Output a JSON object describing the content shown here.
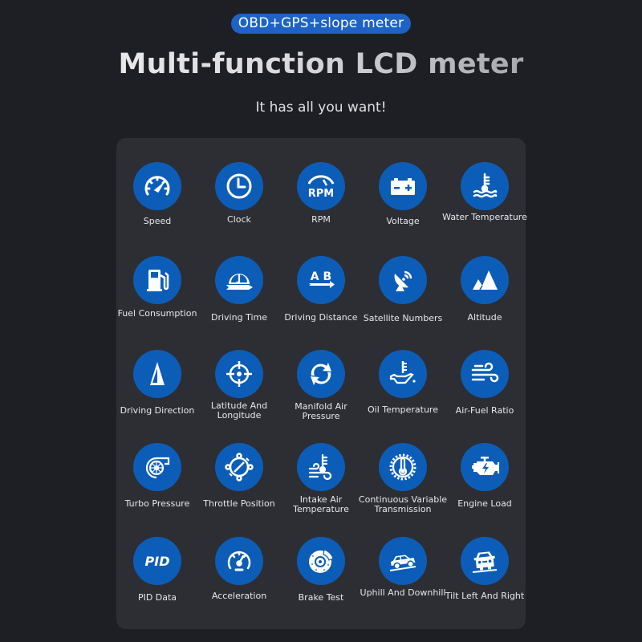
{
  "header": {
    "badge": "OBD+GPS+slope meter",
    "title": "Multi-function LCD meter",
    "subtitle": "It has all you want!"
  },
  "colors": {
    "background": "#1e1f24",
    "panel": "#2c2e33",
    "icon_circle": "#0c5db8",
    "badge": "#1d62c4"
  },
  "features": [
    {
      "label": "Speed",
      "icon": "speedometer-icon"
    },
    {
      "label": "Clock",
      "icon": "clock-icon"
    },
    {
      "label": "RPM",
      "icon": "rpm-gauge-icon",
      "icon_text": "RPM"
    },
    {
      "label": "Voltage",
      "icon": "battery-icon"
    },
    {
      "label": "Water Temperature",
      "icon": "water-temperature-icon"
    },
    {
      "label": "Fuel Consumption",
      "icon": "fuel-pump-icon"
    },
    {
      "label": "Driving Time",
      "icon": "driving-time-icon"
    },
    {
      "label": "Driving Distance",
      "icon": "a-to-b-icon",
      "icon_text": "A B"
    },
    {
      "label": "Satellite Numbers",
      "icon": "satellite-dish-icon"
    },
    {
      "label": "Altitude",
      "icon": "mountain-icon"
    },
    {
      "label": "Driving Direction",
      "icon": "compass-arrow-icon"
    },
    {
      "label": "Latitude And Longitude",
      "icon": "crosshair-icon"
    },
    {
      "label": "Manifold Air Pressure",
      "icon": "circular-arrows-icon"
    },
    {
      "label": "Oil Temperature",
      "icon": "oil-can-icon"
    },
    {
      "label": "Air-Fuel Ratio",
      "icon": "wind-icon"
    },
    {
      "label": "Turbo Pressure",
      "icon": "turbo-icon"
    },
    {
      "label": "Throttle Position",
      "icon": "throttle-valve-icon"
    },
    {
      "label": "Intake Air Temperature",
      "icon": "intake-air-temperature-icon"
    },
    {
      "label": "Continuous Variable Transmission",
      "icon": "gear-thermometer-icon"
    },
    {
      "label": "Engine Load",
      "icon": "engine-icon"
    },
    {
      "label": "PID Data",
      "icon": "pid-icon",
      "icon_text": "PID"
    },
    {
      "label": "Acceleration",
      "icon": "acceleration-gauge-icon"
    },
    {
      "label": "Brake Test",
      "icon": "brake-disc-icon"
    },
    {
      "label": "Uphill And Downhill",
      "icon": "car-side-slope-icon"
    },
    {
      "label": "Tilt Left And Right",
      "icon": "car-front-tilt-icon"
    }
  ]
}
